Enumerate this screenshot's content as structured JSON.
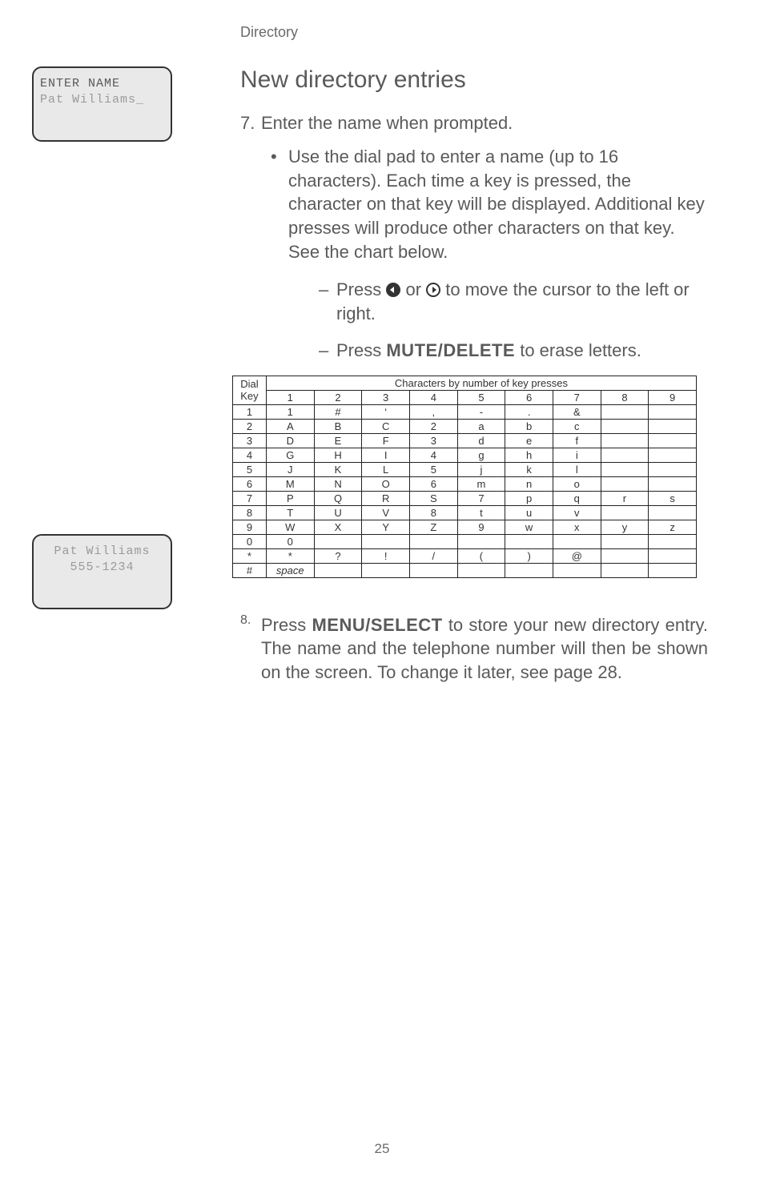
{
  "section_label": "Directory",
  "title": "New directory entries",
  "lcd1": {
    "line1": "ENTER NAME",
    "line2": "Pat Williams_"
  },
  "lcd2": {
    "line1": "Pat Williams",
    "line2": "555-1234"
  },
  "step7": {
    "num": "7.",
    "text": "Enter the name when prompted.",
    "bullet_dot": "•",
    "bullet_text": "Use the dial pad to enter a name (up to 16 characters). Each time a key is pressed, the character on that key will be displayed. Additional key presses will produce other characters on that key. See the chart below.",
    "sub_dash": "–",
    "sub1_a": "Press ",
    "sub1_b": " or ",
    "sub1_c": " to move the cursor to the left or right.",
    "sub2_a": "Press ",
    "sub2_key": "MUTE/",
    "sub2_key_bold": "DELETE",
    "sub2_b": " to erase letters."
  },
  "keymap": {
    "header_left": "Dial Key",
    "header_span": "Characters by number of key presses",
    "cols": [
      "1",
      "2",
      "3",
      "4",
      "5",
      "6",
      "7",
      "8",
      "9"
    ],
    "rows": [
      {
        "key": "1",
        "cells": [
          "1",
          "#",
          "‘",
          ",",
          "-",
          ".",
          "&",
          "",
          ""
        ]
      },
      {
        "key": "2",
        "cells": [
          "A",
          "B",
          "C",
          "2",
          "a",
          "b",
          "c",
          "",
          ""
        ]
      },
      {
        "key": "3",
        "cells": [
          "D",
          "E",
          "F",
          "3",
          "d",
          "e",
          "f",
          "",
          ""
        ]
      },
      {
        "key": "4",
        "cells": [
          "G",
          "H",
          "I",
          "4",
          "g",
          "h",
          "i",
          "",
          ""
        ]
      },
      {
        "key": "5",
        "cells": [
          "J",
          "K",
          "L",
          "5",
          "j",
          "k",
          "l",
          "",
          ""
        ]
      },
      {
        "key": "6",
        "cells": [
          "M",
          "N",
          "O",
          "6",
          "m",
          "n",
          "o",
          "",
          ""
        ]
      },
      {
        "key": "7",
        "cells": [
          "P",
          "Q",
          "R",
          "S",
          "7",
          "p",
          "q",
          "r",
          "s"
        ]
      },
      {
        "key": "8",
        "cells": [
          "T",
          "U",
          "V",
          "8",
          "t",
          "u",
          "v",
          "",
          ""
        ]
      },
      {
        "key": "9",
        "cells": [
          "W",
          "X",
          "Y",
          "Z",
          "9",
          "w",
          "x",
          "y",
          "z"
        ]
      },
      {
        "key": "0",
        "cells": [
          "0",
          "",
          "",
          "",
          "",
          "",
          "",
          "",
          ""
        ]
      },
      {
        "key": "*",
        "cells": [
          "*",
          "?",
          "!",
          "/",
          "(",
          ")",
          "@",
          "",
          ""
        ]
      },
      {
        "key": "#",
        "cells": [
          "space",
          "",
          "",
          "",
          "",
          "",
          "",
          "",
          ""
        ]
      }
    ]
  },
  "step8": {
    "num": "8.",
    "a": "Press ",
    "key": "MENU/",
    "key_bold": "SELECT",
    "b": " to store your new directory entry. The name and the telephone number will then be shown on the screen. To change it later, see page 28."
  },
  "page_number": "25"
}
